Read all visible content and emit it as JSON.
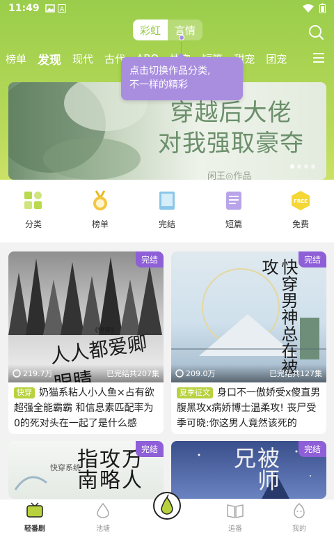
{
  "status": {
    "time": "11:49"
  },
  "switcher": {
    "active": "彩虹",
    "inactive": "言情"
  },
  "tabs": [
    "榜单",
    "发现",
    "现代",
    "古代",
    "ABO",
    "快穿",
    "短篇",
    "甜宠",
    "团宠"
  ],
  "active_tab": "发现",
  "tooltip": {
    "line1": "点击切换作品分类,",
    "line2": "不一样的精彩"
  },
  "banner": {
    "title_line1": "穿越后大佬",
    "title_line2": "对我强取豪夺",
    "author": "闲王◎作品"
  },
  "quick": [
    {
      "label": "分类",
      "icon": "category-icon"
    },
    {
      "label": "榜单",
      "icon": "medal-icon"
    },
    {
      "label": "完结",
      "icon": "book-icon"
    },
    {
      "label": "短篇",
      "icon": "document-icon"
    },
    {
      "label": "免费",
      "icon": "free-icon"
    }
  ],
  "cards": [
    {
      "badge": "完结",
      "views": "219.7万",
      "episodes": "已完结共207集",
      "tag": "快穿",
      "tag_color": "#b7d23d",
      "desc": "奶猫系粘人小人鱼×占有欲超强全能霸霸 和信息素匹配率为0的死对头在一起了是什么感",
      "cover_text": "人人都爱卿眼睛",
      "cover_sub": "《快穿》"
    },
    {
      "badge": "完结",
      "views": "209.0万",
      "episodes": "已完结共127集",
      "tag": "夏季征文",
      "tag_color": "#b7d23d",
      "desc": "身口不一傲娇受x傻直男腹黑攻x病娇博士温柔攻! 丧尸受季可晓:你这男人竟然该死的",
      "cover_text": "快穿男神总在被攻",
      "cover_sub": ""
    },
    {
      "badge": "完结",
      "cover_text": "万人攻略指南",
      "cover_sub": "快穿系统"
    },
    {
      "badge": "完结",
      "cover_text": "被师兄",
      "cover_sub": ""
    }
  ],
  "nav": [
    {
      "label": "轻番剧",
      "icon": "tv-icon"
    },
    {
      "label": "池塘",
      "icon": "pond-icon"
    },
    {
      "label": "",
      "icon": "pear-icon"
    },
    {
      "label": "追番",
      "icon": "bookshelf-icon"
    },
    {
      "label": "我的",
      "icon": "profile-icon"
    }
  ]
}
